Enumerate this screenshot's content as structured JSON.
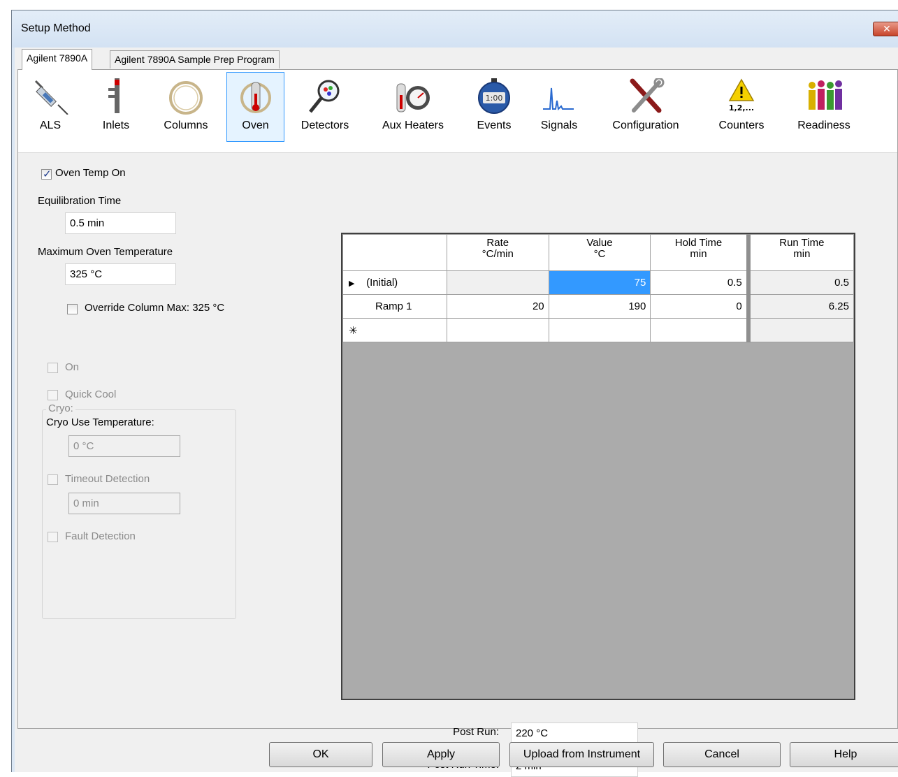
{
  "window": {
    "title": "Setup Method",
    "close_glyph": "✕"
  },
  "tabs": [
    {
      "label": "Agilent 7890A",
      "selected": true
    },
    {
      "label": "Agilent 7890A Sample Prep Program",
      "selected": false
    }
  ],
  "toolbar": [
    {
      "label": "ALS",
      "icon": "syringe-icon"
    },
    {
      "label": "Inlets",
      "icon": "inlet-icon"
    },
    {
      "label": "Columns",
      "icon": "column-coil-icon"
    },
    {
      "label": "Oven",
      "icon": "oven-thermometer-icon",
      "selected": true
    },
    {
      "label": "Detectors",
      "icon": "detector-magnifier-icon"
    },
    {
      "label": "Aux Heaters",
      "icon": "aux-heater-gauge-icon"
    },
    {
      "label": "Events",
      "icon": "stopwatch-icon",
      "icon_text": "1:00"
    },
    {
      "label": "Signals",
      "icon": "signal-peaks-icon"
    },
    {
      "label": "Configuration",
      "icon": "wrench-screwdriver-icon"
    },
    {
      "label": "Counters",
      "icon": "warning-counter-icon",
      "icon_text": "1,2,..."
    },
    {
      "label": "Readiness",
      "icon": "people-readiness-icon"
    }
  ],
  "oven": {
    "oven_temp_on_label": "Oven Temp On",
    "oven_temp_on": true,
    "equilibration_label": "Equilibration Time",
    "equilibration_value": "0.5 min",
    "max_temp_label": "Maximum Oven Temperature",
    "max_temp_value": "325 °C",
    "override_label": "Override Column Max: 325 °C",
    "override_checked": false
  },
  "cryo": {
    "group_label": "Cryo:",
    "on_label": "On",
    "quick_cool_label": "Quick Cool",
    "use_temp_label": "Cryo Use Temperature:",
    "use_temp_value": "0 °C",
    "timeout_label": "Timeout Detection",
    "timeout_value": "0 min",
    "fault_label": "Fault Detection"
  },
  "ramp_table": {
    "headers": [
      {
        "line1": "Rate",
        "line2": "°C/min"
      },
      {
        "line1": "Value",
        "line2": "°C"
      },
      {
        "line1": "Hold Time",
        "line2": "min"
      },
      {
        "line1": "Run Time",
        "line2": "min"
      }
    ],
    "rows": [
      {
        "marker": "▶",
        "label": "(Initial)",
        "rate": "",
        "value": "75",
        "hold": "0.5",
        "run": "0.5"
      },
      {
        "marker": "",
        "label": "Ramp 1",
        "rate": "20",
        "value": "190",
        "hold": "0",
        "run": "6.25"
      },
      {
        "marker": "✳",
        "label": "",
        "rate": "",
        "value": "",
        "hold": "",
        "run": ""
      }
    ]
  },
  "post_run": {
    "post_run_label": "Post Run:",
    "post_run_value": "220 °C",
    "post_run_time_label": "Post Run Time:",
    "post_run_time_value": "2 min"
  },
  "buttons": {
    "ok": "OK",
    "apply": "Apply",
    "upload": "Upload from Instrument",
    "cancel": "Cancel",
    "help": "Help"
  }
}
